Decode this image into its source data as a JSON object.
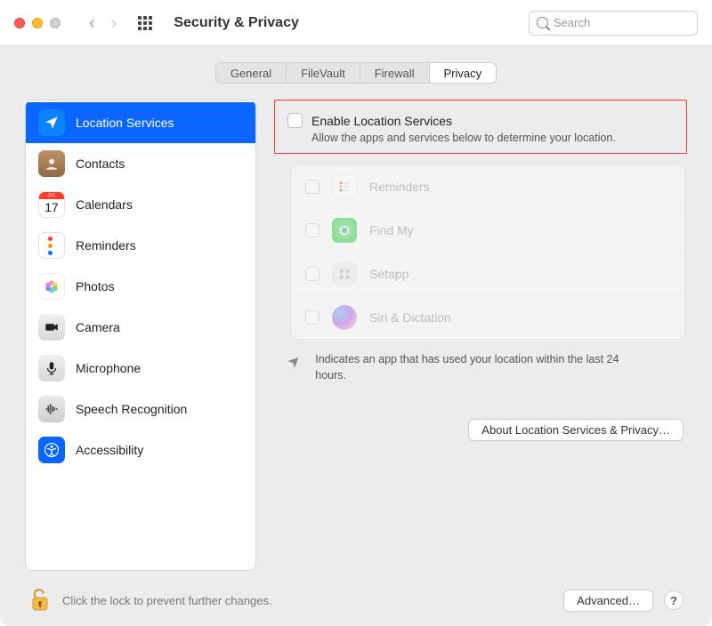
{
  "window": {
    "title": "Security & Privacy"
  },
  "search": {
    "placeholder": "Search"
  },
  "tabs": [
    {
      "label": "General"
    },
    {
      "label": "FileVault"
    },
    {
      "label": "Firewall"
    },
    {
      "label": "Privacy",
      "active": true
    }
  ],
  "sidebar": {
    "items": [
      {
        "label": "Location Services",
        "selected": true
      },
      {
        "label": "Contacts"
      },
      {
        "label": "Calendars",
        "day": "17",
        "month": "JUL"
      },
      {
        "label": "Reminders"
      },
      {
        "label": "Photos"
      },
      {
        "label": "Camera"
      },
      {
        "label": "Microphone"
      },
      {
        "label": "Speech Recognition"
      },
      {
        "label": "Accessibility"
      }
    ]
  },
  "detail": {
    "enable_label": "Enable Location Services",
    "enable_sub": "Allow the apps and services below to determine your location.",
    "apps": [
      {
        "label": "Reminders"
      },
      {
        "label": "Find My"
      },
      {
        "label": "Setapp"
      },
      {
        "label": "Siri & Dictation"
      }
    ],
    "indicator_text": "Indicates an app that has used your location within the last 24 hours.",
    "about_button": "About Location Services & Privacy…"
  },
  "footer": {
    "text": "Click the lock to prevent further changes.",
    "advanced": "Advanced…",
    "help": "?"
  }
}
